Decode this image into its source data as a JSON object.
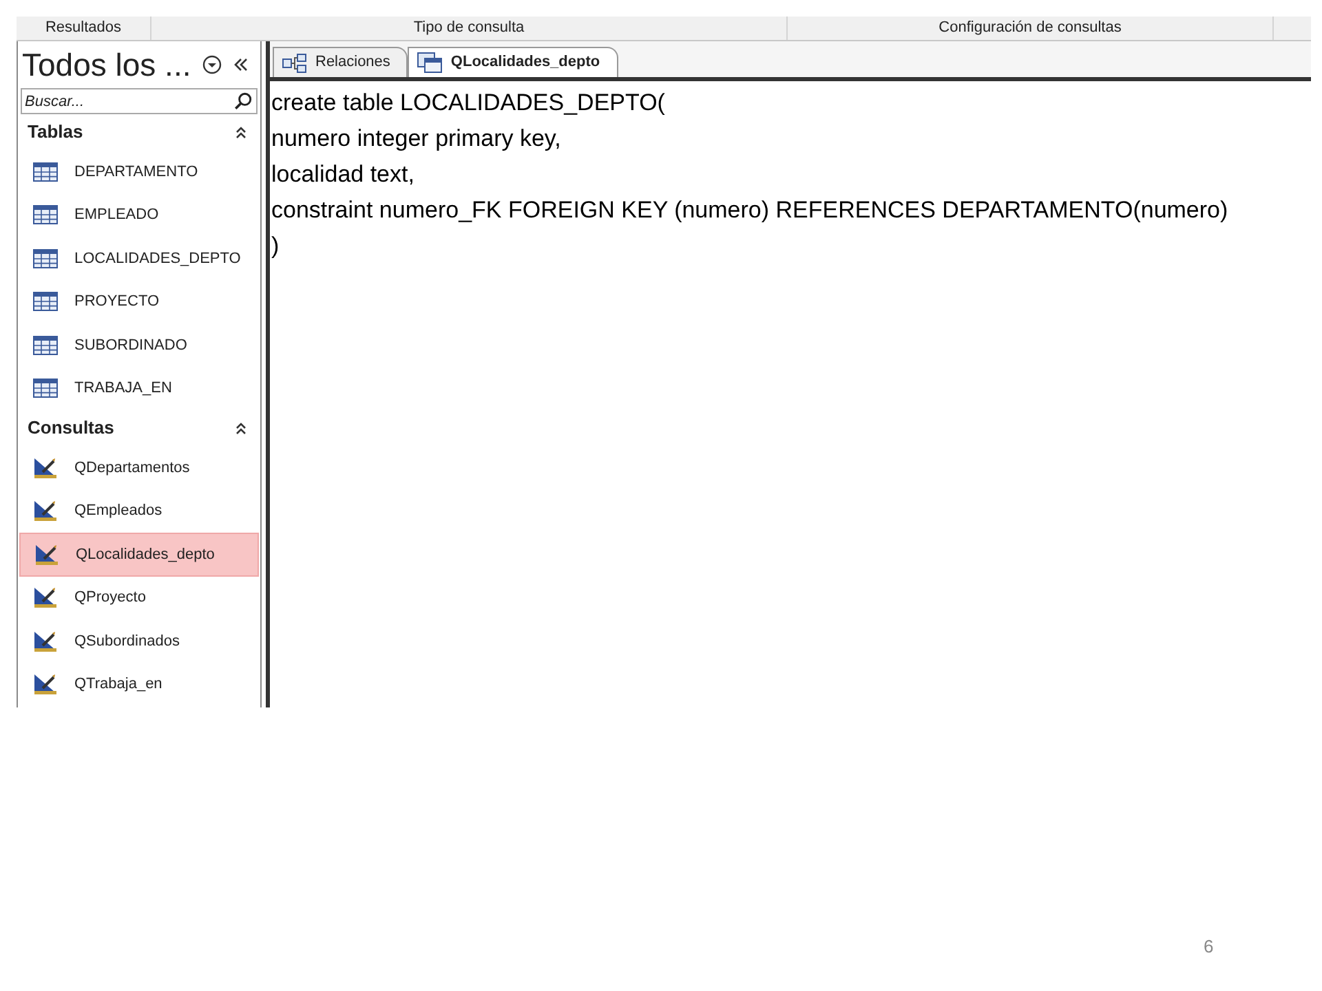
{
  "ribbon_groups": [
    "Resultados",
    "Tipo de consulta",
    "Configuración de consultas"
  ],
  "nav_pane": {
    "title": "Todos los ...",
    "search": {
      "placeholder": "Buscar..."
    },
    "sections": [
      {
        "title": "Tablas",
        "kind": "table",
        "expanded": true,
        "items": [
          {
            "label": "DEPARTAMENTO",
            "selected": false
          },
          {
            "label": "EMPLEADO",
            "selected": false
          },
          {
            "label": "LOCALIDADES_DEPTO",
            "selected": false
          },
          {
            "label": "PROYECTO",
            "selected": false
          },
          {
            "label": "SUBORDINADO",
            "selected": false
          },
          {
            "label": "TRABAJA_EN",
            "selected": false
          }
        ]
      },
      {
        "title": "Consultas",
        "kind": "query",
        "expanded": true,
        "items": [
          {
            "label": "QDepartamentos",
            "selected": false
          },
          {
            "label": "QEmpleados",
            "selected": false
          },
          {
            "label": "QLocalidades_depto",
            "selected": true
          },
          {
            "label": "QProyecto",
            "selected": false
          },
          {
            "label": "QSubordinados",
            "selected": false
          },
          {
            "label": "QTrabaja_en",
            "selected": false
          }
        ]
      }
    ]
  },
  "tabs": [
    {
      "label": "Relaciones",
      "kind": "relations",
      "selected": false
    },
    {
      "label": "QLocalidades_depto",
      "kind": "query",
      "selected": true
    }
  ],
  "editor_lines": [
    "create table LOCALIDADES_DEPTO(",
    "numero integer primary key,",
    "localidad text,",
    "constraint numero_FK FOREIGN KEY (numero) REFERENCES DEPARTAMENTO(numero)",
    ")"
  ],
  "page_number": "6"
}
